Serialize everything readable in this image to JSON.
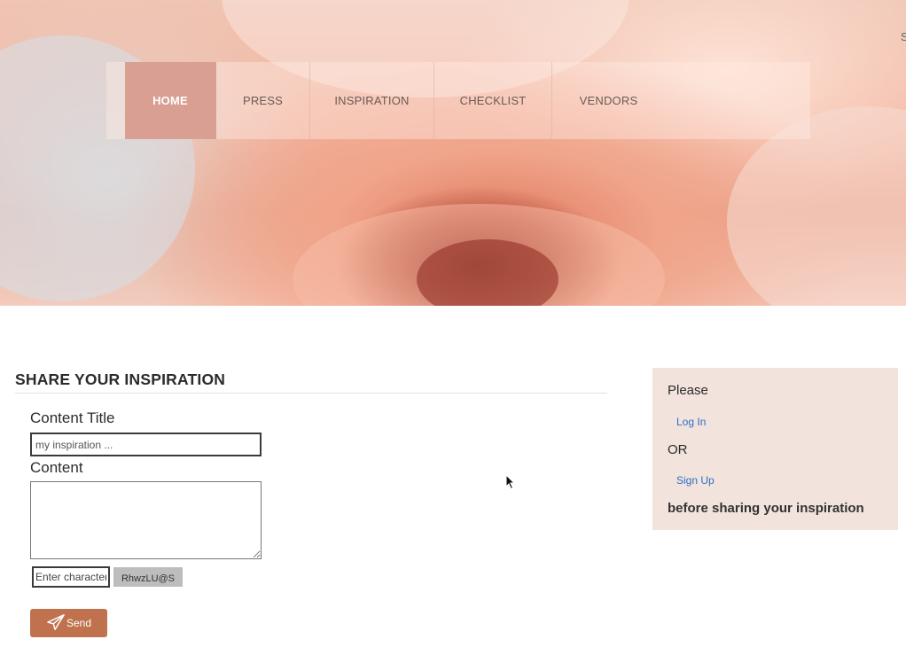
{
  "hero": {
    "edge_char": "S"
  },
  "nav": {
    "items": [
      {
        "label": "HOME",
        "active": true
      },
      {
        "label": "PRESS",
        "active": false
      },
      {
        "label": "INSPIRATION",
        "active": false
      },
      {
        "label": "CHECKLIST",
        "active": false
      },
      {
        "label": "VENDORS",
        "active": false
      }
    ],
    "active_color": "#d99f92"
  },
  "form": {
    "section_title": "SHARE YOUR INSPIRATION",
    "content_title_label": "Content Title",
    "content_title_placeholder": "my inspiration ...",
    "content_title_value": "",
    "content_label": "Content",
    "content_value": "",
    "captcha_placeholder": "Enter characters",
    "captcha_value": "",
    "captcha_image_text": "RhwzLU@S",
    "send_label": "Send",
    "send_icon": "paper-plane-icon",
    "send_color": "#c0724e"
  },
  "sidebar": {
    "please": "Please",
    "login_link": "Log In",
    "or": "OR",
    "signup_link": "Sign Up",
    "before": "before sharing your inspiration",
    "background": "#f2e3dc",
    "link_color": "#2f6fcc"
  }
}
